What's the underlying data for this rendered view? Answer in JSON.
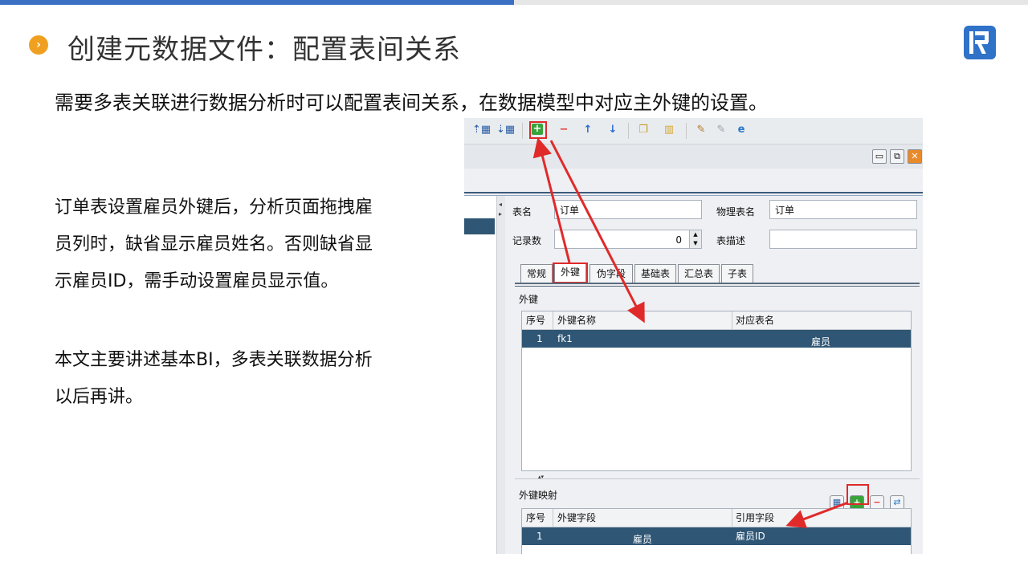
{
  "slide": {
    "bullet_glyph": "›",
    "title": "创建元数据文件：配置表间关系",
    "subtitle": "需要多表关联进行数据分析时可以配置表间关系，在数据模型中对应主外键的设置。",
    "para1_lines": [
      "订单表设置雇员外键后，分析页面拖拽雇",
      "员列时，缺省显示雇员姓名。否则缺省显",
      "示雇员ID，需手动设置雇员显示值。"
    ],
    "para2_lines": [
      "本文主要讲述基本BI，多表关联数据分析",
      "以后再讲。"
    ],
    "accent_color": "#f0a020",
    "brand_color": "#2f72c8"
  },
  "app": {
    "toolbar_icons": [
      "move-up-table-icon",
      "move-down-table-icon",
      "add-icon",
      "remove-icon",
      "arrow-up-icon",
      "arrow-down-icon",
      "copy-icon",
      "database-icon",
      "tool-icon",
      "tool-disabled-icon",
      "ie-icon"
    ],
    "form": {
      "table_name_label": "表名",
      "table_name_value": "订单",
      "physical_name_label": "物理表名",
      "physical_name_value": "订单",
      "record_count_label": "记录数",
      "record_count_value": "0",
      "table_desc_label": "表描述",
      "table_desc_value": ""
    },
    "tabs": [
      "常规",
      "外键",
      "伪字段",
      "基础表",
      "汇总表",
      "子表"
    ],
    "active_tab": "外键",
    "fk_section_label": "外键",
    "fk_table": {
      "headers": [
        "序号",
        "外键名称",
        "对应表名"
      ],
      "rows": [
        {
          "no": "1",
          "name": "fk1",
          "table": "雇员"
        }
      ]
    },
    "mapping_section_label": "外键映射",
    "mapping_table": {
      "headers": [
        "序号",
        "外键字段",
        "引用字段"
      ],
      "rows": [
        {
          "no": "1",
          "field": "雇员",
          "ref": "雇员ID"
        }
      ]
    },
    "highlight_color": "#e02a2a"
  }
}
